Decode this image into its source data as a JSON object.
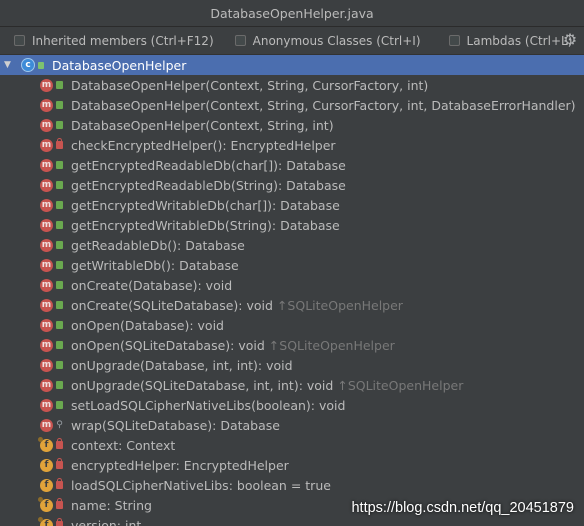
{
  "window": {
    "title": "DatabaseOpenHelper.java"
  },
  "options": [
    {
      "label": "Inherited members (Ctrl+F12)",
      "checked": false
    },
    {
      "label": "Anonymous Classes (Ctrl+I)",
      "checked": false
    },
    {
      "label": "Lambdas (Ctrl+L)",
      "checked": false
    }
  ],
  "settings_icon": "gear-icon",
  "tree": {
    "root": {
      "label": "DatabaseOpenHelper",
      "icon": "class-icon",
      "expanded": true,
      "selected": true
    },
    "members": [
      {
        "kind": "m",
        "access": "public",
        "text": "DatabaseOpenHelper(Context, String, CursorFactory, int)",
        "inherited": ""
      },
      {
        "kind": "m",
        "access": "public",
        "text": "DatabaseOpenHelper(Context, String, CursorFactory, int, DatabaseErrorHandler)",
        "inherited": ""
      },
      {
        "kind": "m",
        "access": "public",
        "text": "DatabaseOpenHelper(Context, String, int)",
        "inherited": ""
      },
      {
        "kind": "m",
        "access": "private",
        "text": "checkEncryptedHelper(): EncryptedHelper",
        "inherited": ""
      },
      {
        "kind": "m",
        "access": "public",
        "text": "getEncryptedReadableDb(char[]): Database",
        "inherited": ""
      },
      {
        "kind": "m",
        "access": "public",
        "text": "getEncryptedReadableDb(String): Database",
        "inherited": ""
      },
      {
        "kind": "m",
        "access": "public",
        "text": "getEncryptedWritableDb(char[]): Database",
        "inherited": ""
      },
      {
        "kind": "m",
        "access": "public",
        "text": "getEncryptedWritableDb(String): Database",
        "inherited": ""
      },
      {
        "kind": "m",
        "access": "public",
        "text": "getReadableDb(): Database",
        "inherited": ""
      },
      {
        "kind": "m",
        "access": "public",
        "text": "getWritableDb(): Database",
        "inherited": ""
      },
      {
        "kind": "m",
        "access": "public",
        "text": "onCreate(Database): void",
        "inherited": ""
      },
      {
        "kind": "m",
        "access": "public",
        "text": "onCreate(SQLiteDatabase): void",
        "inherited": "↑SQLiteOpenHelper"
      },
      {
        "kind": "m",
        "access": "public",
        "text": "onOpen(Database): void",
        "inherited": ""
      },
      {
        "kind": "m",
        "access": "public",
        "text": "onOpen(SQLiteDatabase): void",
        "inherited": "↑SQLiteOpenHelper"
      },
      {
        "kind": "m",
        "access": "public",
        "text": "onUpgrade(Database, int, int): void",
        "inherited": ""
      },
      {
        "kind": "m",
        "access": "public",
        "text": "onUpgrade(SQLiteDatabase, int, int): void",
        "inherited": "↑SQLiteOpenHelper"
      },
      {
        "kind": "m",
        "access": "public",
        "text": "setLoadSQLCipherNativeLibs(boolean): void",
        "inherited": ""
      },
      {
        "kind": "m",
        "access": "package",
        "text": "wrap(SQLiteDatabase): Database",
        "inherited": ""
      },
      {
        "kind": "f",
        "access": "private",
        "final": true,
        "text": "context: Context",
        "inherited": ""
      },
      {
        "kind": "f",
        "access": "private",
        "final": false,
        "text": "encryptedHelper: EncryptedHelper",
        "inherited": ""
      },
      {
        "kind": "f",
        "access": "private",
        "final": false,
        "text": "loadSQLCipherNativeLibs: boolean = true",
        "inherited": ""
      },
      {
        "kind": "f",
        "access": "private",
        "final": true,
        "text": "name: String",
        "inherited": ""
      },
      {
        "kind": "f",
        "access": "private",
        "final": true,
        "text": "version: int",
        "inherited": ""
      }
    ]
  },
  "watermark": "https://blog.csdn.net/qq_20451879"
}
